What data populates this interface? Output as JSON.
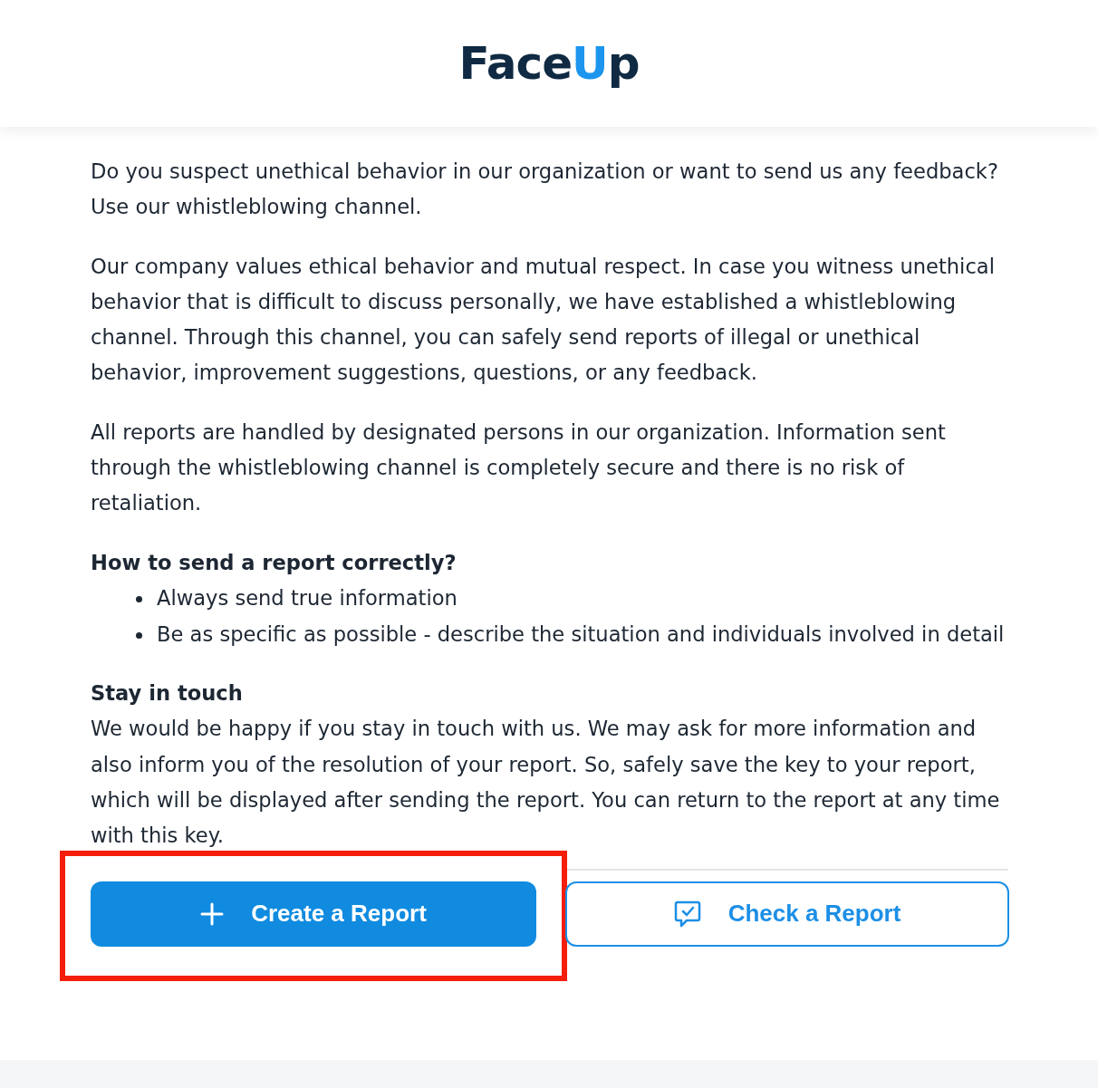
{
  "logo": {
    "lead": "Face",
    "accent": "U",
    "tail": "p"
  },
  "paragraphs": [
    "Do you suspect unethical behavior in our organization or want to send us any feedback? Use our whistleblowing channel.",
    "Our company values ethical behavior and mutual respect. In case you witness unethical behavior that is difficult to discuss personally, we have established a whistleblowing channel. Through this channel, you can safely send reports of illegal or unethical behavior, improvement suggestions, questions, or any feedback.",
    "All reports are handled by designated persons in our organization. Information sent through the whistleblowing channel is completely secure and there is no risk of retaliation."
  ],
  "how_to": {
    "heading": "How to send a report correctly?",
    "bullets": [
      "Always send true information",
      "Be as specific as possible - describe the situation and individuals involved in detail"
    ]
  },
  "stay_in_touch": {
    "heading": "Stay in touch",
    "text": "We would be happy if you stay in touch with us. We may ask for more information and also inform you of the resolution of your report. So, safely save the key to your report, which will be displayed after sending the report. You can return to the report at any time with this key."
  },
  "buttons": [
    {
      "kind": "primary",
      "label": "Create a Report",
      "highlighted": true
    },
    {
      "kind": "outline",
      "label": "Check a Report",
      "highlighted": false
    }
  ]
}
